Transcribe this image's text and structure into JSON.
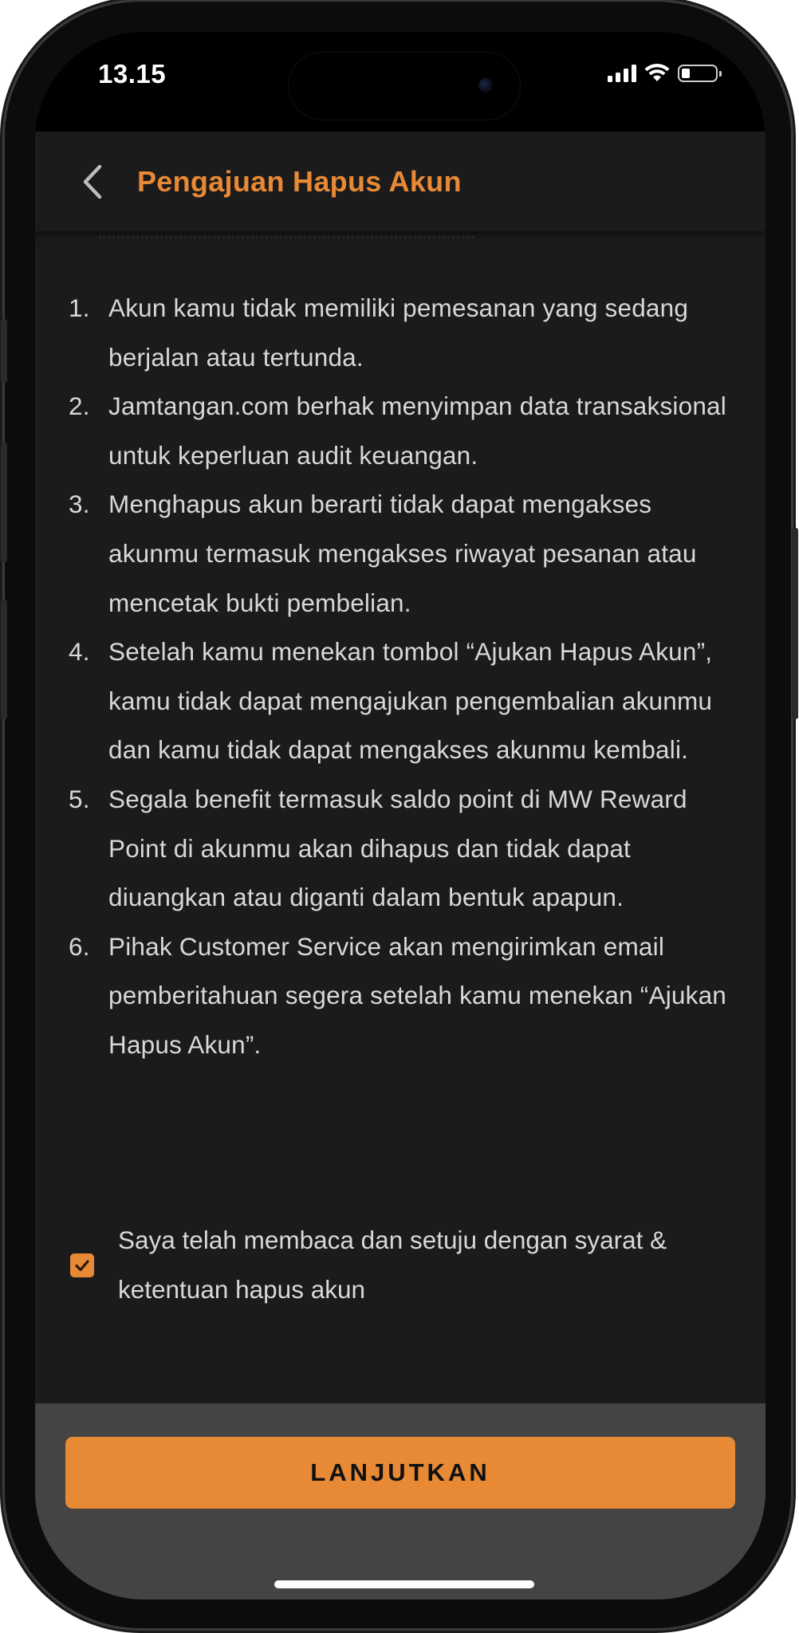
{
  "status_bar": {
    "time": "13.15"
  },
  "header": {
    "title": "Pengajuan Hapus Akun",
    "back_icon": "chevron-left-icon"
  },
  "terms": [
    {
      "num": "1.",
      "text": "Akun kamu tidak memiliki pemesanan yang sedang berjalan atau tertunda."
    },
    {
      "num": "2.",
      "text": "Jamtangan.com berhak menyimpan data transaksional untuk keperluan audit keuangan."
    },
    {
      "num": "3.",
      "text": "Menghapus akun berarti tidak dapat mengakses akunmu termasuk mengakses riwayat pesanan atau mencetak bukti pembelian."
    },
    {
      "num": "4.",
      "text": "Setelah kamu menekan tombol “Ajukan Hapus Akun”, kamu tidak dapat mengajukan pengembalian akunmu dan kamu tidak dapat mengakses akunmu kembali."
    },
    {
      "num": "5.",
      "text": "Segala benefit termasuk saldo point di MW Reward Point di akunmu akan dihapus dan tidak dapat diuangkan atau diganti dalam bentuk apapun."
    },
    {
      "num": "6.",
      "text": "Pihak Customer Service akan mengirimkan email pemberitahuan segera setelah kamu menekan “Ajukan Hapus Akun”."
    }
  ],
  "agreement": {
    "label": "Saya telah membaca dan setuju dengan syarat & ketentuan hapus akun",
    "checked": true
  },
  "actions": {
    "continue_label": "LANJUTKAN"
  },
  "colors": {
    "accent": "#e88935",
    "surface": "#1b1b1b",
    "bottom_bar": "#444444",
    "text": "#d8d8d8"
  }
}
